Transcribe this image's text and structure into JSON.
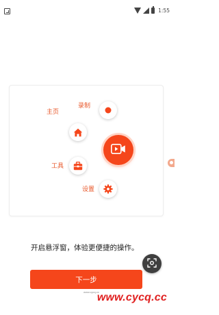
{
  "status_bar": {
    "time": "1:55"
  },
  "menu": {
    "items": [
      {
        "key": "record",
        "label": "录制",
        "icon": "record-dot-icon"
      },
      {
        "key": "home",
        "label": "主页",
        "icon": "home-icon"
      },
      {
        "key": "tools",
        "label": "工具",
        "icon": "toolbox-icon"
      },
      {
        "key": "settings",
        "label": "设置",
        "icon": "gear-icon"
      }
    ],
    "center_icon": "video-camera-icon"
  },
  "hint": "开启悬浮窗，体验更便捷的操作。",
  "next_button_label": "下一步",
  "watermark": {
    "text": "www.cycq.cc",
    "small": "www.cycq.cc"
  },
  "colors": {
    "accent": "#f5461b",
    "label": "#e8582b",
    "fab": "#3f3f3f"
  }
}
